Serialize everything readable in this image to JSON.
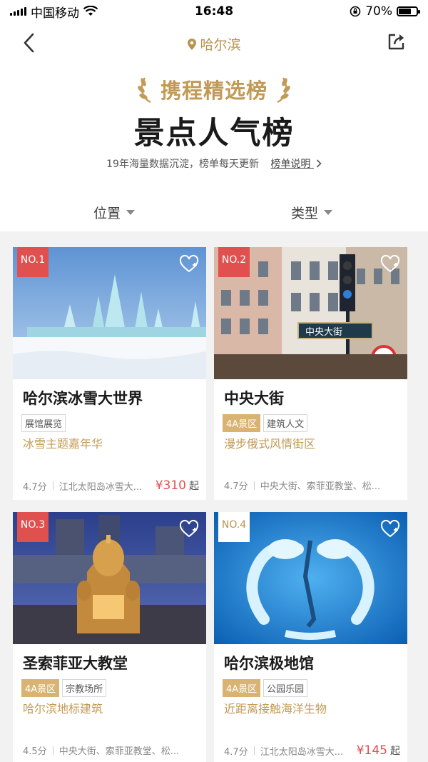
{
  "status": {
    "carrier": "中国移动",
    "time": "16:48",
    "battery": "70%",
    "battery_level": 0.7
  },
  "nav": {
    "city": "哈尔滨"
  },
  "header": {
    "brand": "携程精选榜",
    "title": "景点人气榜",
    "subtitle": "19年海量数据沉淀，榜单每天更新",
    "link": "榜单说明"
  },
  "filters": {
    "position": "位置",
    "type": "类型"
  },
  "cards": [
    {
      "rank": "NO.1",
      "name": "哈尔滨冰雪大世界",
      "tags": [
        "展馆展览"
      ],
      "desc": "冰雪主题嘉年华",
      "score": "4.7分",
      "location": "江北太阳岛冰雪大...",
      "price": "¥310",
      "qi": "起"
    },
    {
      "rank": "NO.2",
      "name": "中央大街",
      "tags": [
        "4A景区",
        "建筑人文"
      ],
      "desc": "漫步俄式风情街区",
      "score": "4.7分",
      "location": "中央大街、索菲亚教堂、松...",
      "price": "",
      "qi": "",
      "sign_text": "中央大街"
    },
    {
      "rank": "NO.3",
      "name": "圣索菲亚大教堂",
      "tags": [
        "4A景区",
        "宗教场所"
      ],
      "desc": "哈尔滨地标建筑",
      "score": "4.5分",
      "location": "中央大街、索菲亚教堂、松...",
      "price": "",
      "qi": ""
    },
    {
      "rank": "NO.4",
      "name": "哈尔滨极地馆",
      "tags": [
        "4A景区",
        "公园乐园"
      ],
      "desc": "近距离接触海洋生物",
      "score": "4.7分",
      "location": "江北太阳岛冰雪大...",
      "price": "¥145",
      "qi": "起"
    }
  ]
}
